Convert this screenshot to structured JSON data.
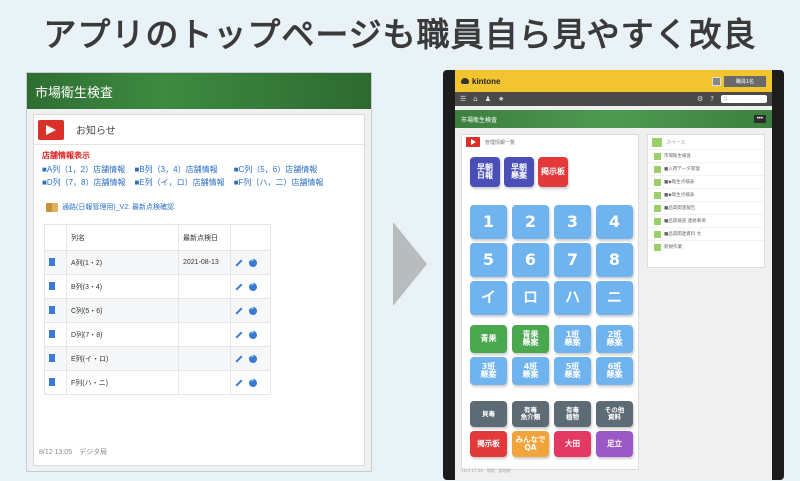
{
  "headline": "アプリのトップページも職員自ら見やすく改良",
  "left": {
    "app_title": "市場衛生検査",
    "notice_title": "お知らせ",
    "store_title": "店舗情報表示",
    "store_links": [
      "■A列（1，2）店舗情報",
      "■B列（3，4）店舗情報",
      "■C列（5，6）店舗情報",
      "■D列（7，8）店舗情報",
      "■E列（イ，ロ）店舗情報",
      "■F列（ハ，二）店舗情報"
    ],
    "check_link": "通路(日報管理用)_V2: 最新点検確認",
    "table": {
      "headers": [
        "",
        "列名",
        "最新点検日",
        ""
      ],
      "rows": [
        {
          "name": "A列(1・2)",
          "date": "2021-08-13"
        },
        {
          "name": "B列(3・4)",
          "date": ""
        },
        {
          "name": "C列(5・6)",
          "date": ""
        },
        {
          "name": "D列(7・8)",
          "date": ""
        },
        {
          "name": "E列(イ・ロ)",
          "date": ""
        },
        {
          "name": "F列(ハ・ニ)",
          "date": ""
        }
      ]
    },
    "footer": "8/12 13:05　デジタ局"
  },
  "right": {
    "brand": "kintone",
    "user_name": "職員1名",
    "search_placeholder": "Q",
    "space_title": "市場衛生検査",
    "more": "•••",
    "main_header": "管理情報一覧",
    "tiles": [
      {
        "label": "早朝\n日報",
        "color": "#4a4fb8"
      },
      {
        "label": "早朝\n懸案",
        "color": "#4a4fb8"
      },
      {
        "label": "掲示板",
        "color": "#e23a3a"
      },
      {
        "label": "1",
        "color": "#6fb3ef"
      },
      {
        "label": "2",
        "color": "#6fb3ef"
      },
      {
        "label": "3",
        "color": "#6fb3ef"
      },
      {
        "label": "4",
        "color": "#6fb3ef"
      },
      {
        "label": "5",
        "color": "#6fb3ef"
      },
      {
        "label": "6",
        "color": "#6fb3ef"
      },
      {
        "label": "7",
        "color": "#6fb3ef"
      },
      {
        "label": "8",
        "color": "#6fb3ef"
      },
      {
        "label": "イ",
        "color": "#6fb3ef"
      },
      {
        "label": "ロ",
        "color": "#6fb3ef"
      },
      {
        "label": "ハ",
        "color": "#6fb3ef"
      },
      {
        "label": "ニ",
        "color": "#6fb3ef"
      },
      {
        "label": "青果",
        "color": "#4aa84e"
      },
      {
        "label": "青果\n懸案",
        "color": "#4aa84e"
      },
      {
        "label": "1班\n懸案",
        "color": "#6fb3ef"
      },
      {
        "label": "2班\n懸案",
        "color": "#6fb3ef"
      },
      {
        "label": "3班\n懸案",
        "color": "#6fb3ef"
      },
      {
        "label": "4班\n懸案",
        "color": "#6fb3ef"
      },
      {
        "label": "5班\n懸案",
        "color": "#6fb3ef"
      },
      {
        "label": "6班\n懸案",
        "color": "#6fb3ef"
      },
      {
        "label": "貝毒",
        "color": "#5d6b75"
      },
      {
        "label": "有毒\n魚介類",
        "color": "#5d6b75"
      },
      {
        "label": "有毒\n植物",
        "color": "#5d6b75"
      },
      {
        "label": "その他\n資料",
        "color": "#5d6b75"
      },
      {
        "label": "掲示板",
        "color": "#e23a3a"
      },
      {
        "label": "みんなで\nQA",
        "color": "#f0a43a"
      },
      {
        "label": "大田",
        "color": "#e23a63"
      },
      {
        "label": "足立",
        "color": "#9b59c7"
      }
    ],
    "side_header": "スペース",
    "side_items": [
      "市場衛生検査",
      "■入荷データ管理",
      "■◆衛生点検表",
      "■◆衛生点検表",
      "■品質関連報告",
      "■品質検査 連絡事項",
      "■品質関連資料 文",
      "新規作業"
    ],
    "bottom_text": "11/4 17:54　閲覧：管理者"
  }
}
